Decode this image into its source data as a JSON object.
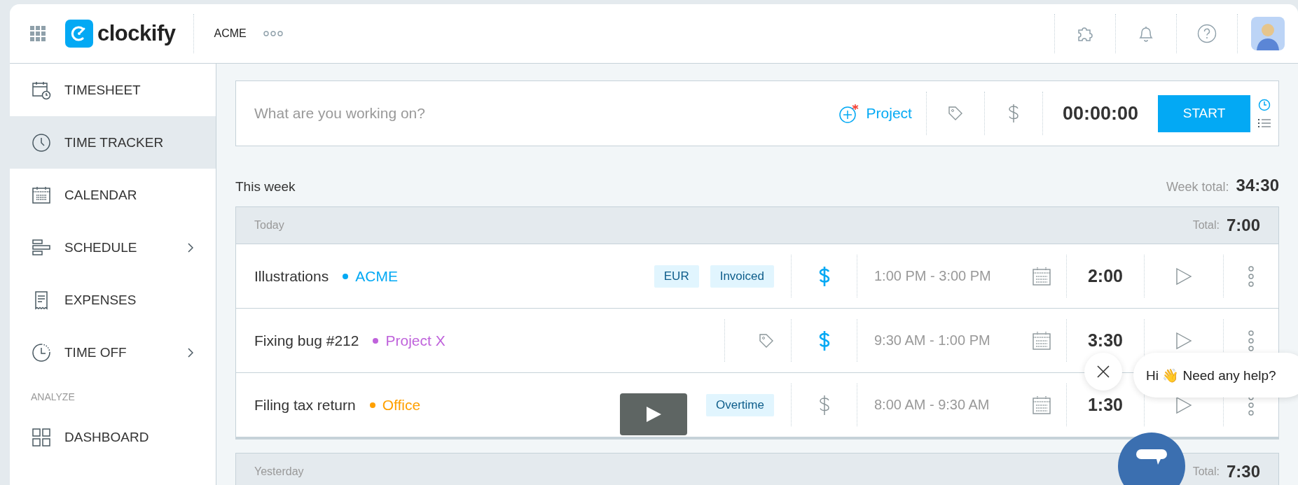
{
  "top_bar": {
    "logo": "clockify",
    "workspace": "ACME"
  },
  "sidebar": {
    "items": [
      {
        "label": "TIMESHEET",
        "selected": false,
        "expandable": false
      },
      {
        "label": "TIME TRACKER",
        "selected": true,
        "expandable": false
      },
      {
        "label": "CALENDAR",
        "selected": false,
        "expandable": false
      },
      {
        "label": "SCHEDULE",
        "selected": false,
        "expandable": true
      },
      {
        "label": "EXPENSES",
        "selected": false,
        "expandable": false
      },
      {
        "label": "TIME OFF",
        "selected": false,
        "expandable": true
      }
    ],
    "section": "ANALYZE",
    "section_items": [
      {
        "label": "DASHBOARD",
        "selected": false
      }
    ]
  },
  "entry_bar": {
    "placeholder": "What are you working on?",
    "project_button": "Project",
    "timer": "00:00:00",
    "start_button": "START"
  },
  "week": {
    "label": "This week",
    "total_label": "Week total:",
    "total": "34:30"
  },
  "days": [
    {
      "label": "Today",
      "total_label": "Total:",
      "total": "7:00",
      "entries": [
        {
          "description": "Illustrations",
          "project": "ACME",
          "color": "#03a9f4",
          "tags": [
            "EUR",
            "Invoiced"
          ],
          "billable": true,
          "time_range": "1:00 PM - 3:00 PM",
          "duration": "2:00"
        },
        {
          "description": "Fixing bug #212",
          "project": "Project X",
          "color": "#bf62db",
          "billable": true,
          "time_range": "9:30 AM - 1:00 PM",
          "duration": "3:30"
        },
        {
          "description": "Filing tax return",
          "project": "Office",
          "color": "#ffa000",
          "tags": [
            "Overtime"
          ],
          "billable": false,
          "time_range": "8:00 AM - 9:30 AM",
          "duration": "1:30"
        }
      ]
    },
    {
      "label": "Yesterday",
      "total_label": "Total:",
      "total": "7:30"
    }
  ],
  "chat": {
    "greeting": "Hi 👋 Need any help?"
  }
}
